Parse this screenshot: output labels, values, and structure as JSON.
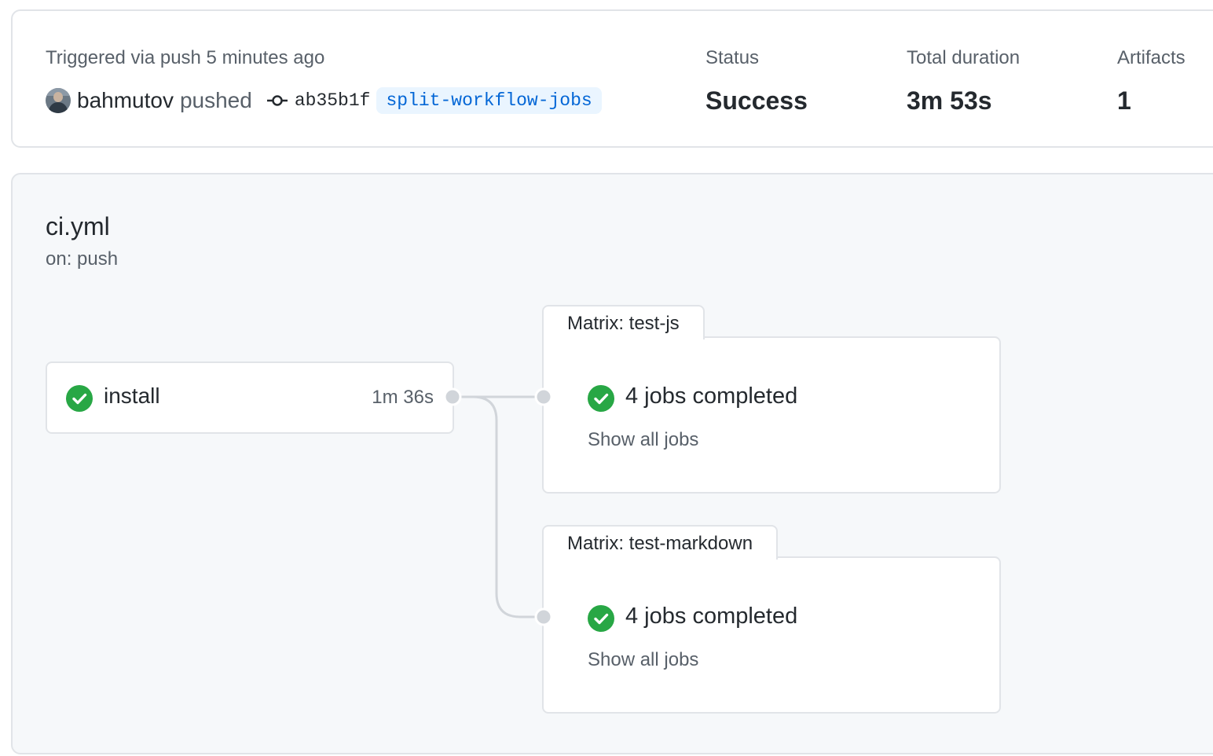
{
  "summary": {
    "trigger_text": "Triggered via push 5 minutes ago",
    "pusher": "bahmutov",
    "action": "pushed",
    "commit_sha": "ab35b1f",
    "branch": "split-workflow-jobs",
    "status_label": "Status",
    "status_value": "Success",
    "duration_label": "Total duration",
    "duration_value": "3m 53s",
    "artifacts_label": "Artifacts",
    "artifacts_value": "1"
  },
  "workflow": {
    "file": "ci.yml",
    "trigger": "on: push",
    "job": {
      "name": "install",
      "duration": "1m 36s",
      "status": "success",
      "icon": "check-circle-icon"
    },
    "matrices": [
      {
        "label": "Matrix: test-js",
        "summary": "4 jobs completed",
        "link": "Show all jobs",
        "status": "success"
      },
      {
        "label": "Matrix: test-markdown",
        "summary": "4 jobs completed",
        "link": "Show all jobs",
        "status": "success"
      }
    ]
  },
  "colors": {
    "success": "#28a745",
    "link": "#0366d6",
    "muted": "#586069",
    "connector": "#d1d5da"
  }
}
